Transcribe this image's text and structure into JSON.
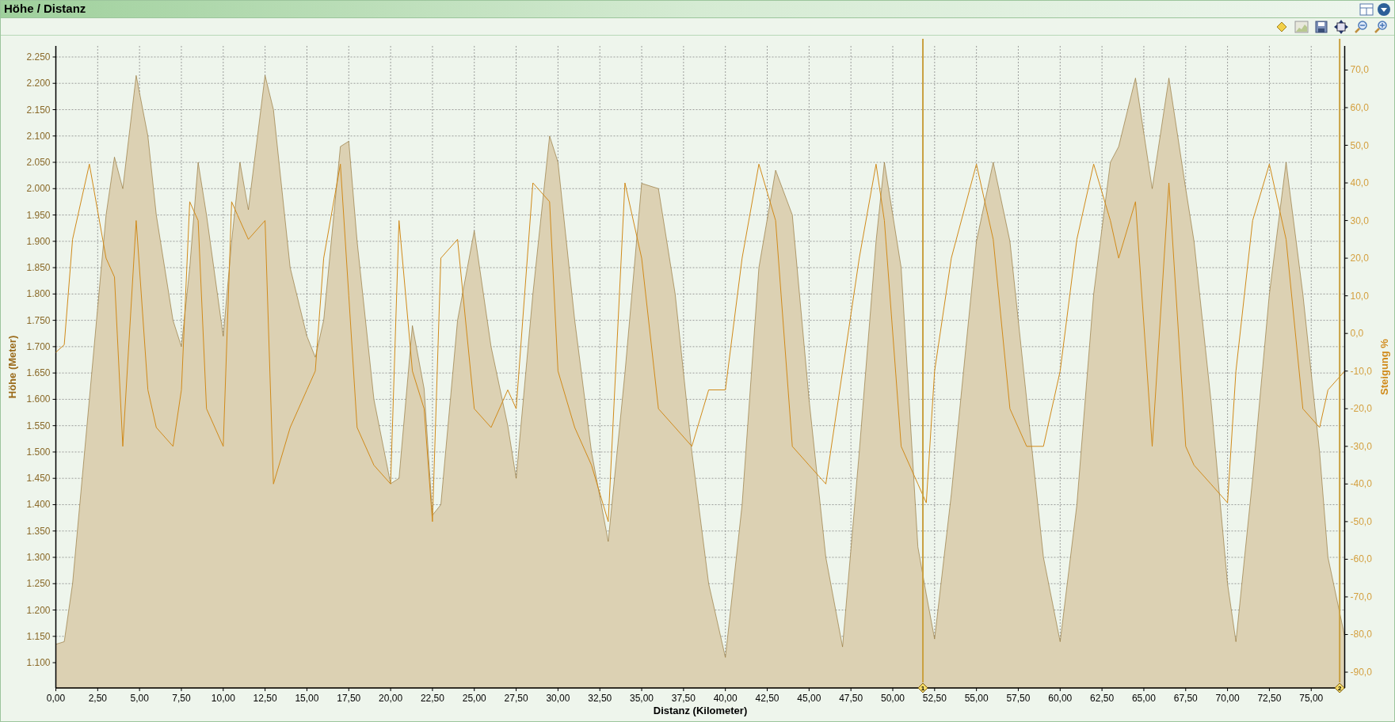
{
  "panel": {
    "title": "Höhe / Distanz"
  },
  "elevation_chart": {
    "chart_data": {
      "type": "area",
      "grid": true,
      "xlabel": "Distanz (Kilometer)",
      "ylabel": "Höhe (Meter)",
      "xlim": [
        0,
        77
      ],
      "ylim": [
        1052,
        2271
      ],
      "x": [
        0,
        0.5,
        1,
        2,
        3,
        3.5,
        4,
        4.8,
        5.5,
        6,
        7,
        7.5,
        8,
        8.5,
        9,
        10,
        10.5,
        11,
        11.5,
        12.5,
        13,
        14,
        15,
        15.5,
        16,
        17,
        17.5,
        18,
        19,
        20,
        20.5,
        21.3,
        22,
        22.5,
        23,
        24,
        25,
        26,
        27,
        27.5,
        28.5,
        29.5,
        30,
        31,
        32,
        33,
        34,
        35,
        36,
        37,
        38,
        39,
        40,
        41,
        42,
        43,
        44,
        45,
        46,
        47,
        48,
        49,
        49.5,
        50.5,
        51.5,
        52,
        52.5,
        53.5,
        55,
        56,
        57,
        58,
        59,
        60,
        61,
        62,
        63,
        63.5,
        64.5,
        65.5,
        66.5,
        67.5,
        68,
        69,
        70,
        70.5,
        71.5,
        72.5,
        73.5,
        74.5,
        75.5,
        76,
        77
      ],
      "series": [
        {
          "color": "#8b6a2a",
          "values": [
            1135,
            1140,
            1250,
            1600,
            1950,
            2060,
            2000,
            2215,
            2100,
            1950,
            1750,
            1700,
            1850,
            2050,
            1950,
            1720,
            1900,
            2050,
            1960,
            2215,
            2150,
            1850,
            1720,
            1680,
            1750,
            2080,
            2090,
            1900,
            1600,
            1440,
            1450,
            1740,
            1620,
            1380,
            1400,
            1750,
            1920,
            1700,
            1550,
            1450,
            1800,
            2100,
            2050,
            1750,
            1500,
            1330,
            1650,
            2010,
            2000,
            1800,
            1500,
            1250,
            1110,
            1400,
            1850,
            2035,
            1950,
            1600,
            1300,
            1130,
            1500,
            1900,
            2050,
            1850,
            1320,
            1230,
            1145,
            1420,
            1900,
            2050,
            1900,
            1600,
            1300,
            1140,
            1400,
            1800,
            2050,
            2080,
            2210,
            2000,
            2210,
            2000,
            1900,
            1600,
            1250,
            1140,
            1450,
            1800,
            2050,
            1800,
            1500,
            1300,
            1150
          ]
        }
      ],
      "xticks": [
        {
          "value": 0,
          "label": "0,00"
        },
        {
          "value": 2.5,
          "label": "2,50"
        },
        {
          "value": 5,
          "label": "5,00"
        },
        {
          "value": 7.5,
          "label": "7,50"
        },
        {
          "value": 10,
          "label": "10,00"
        },
        {
          "value": 12.5,
          "label": "12,50"
        },
        {
          "value": 15,
          "label": "15,00"
        },
        {
          "value": 17.5,
          "label": "17,50"
        },
        {
          "value": 20,
          "label": "20,00"
        },
        {
          "value": 22.5,
          "label": "22,50"
        },
        {
          "value": 25,
          "label": "25,00"
        },
        {
          "value": 27.5,
          "label": "27,50"
        },
        {
          "value": 30,
          "label": "30,00"
        },
        {
          "value": 32.5,
          "label": "32,50"
        },
        {
          "value": 35,
          "label": "35,00"
        },
        {
          "value": 37.5,
          "label": "37,50"
        },
        {
          "value": 40,
          "label": "40,00"
        },
        {
          "value": 42.5,
          "label": "42,50"
        },
        {
          "value": 45,
          "label": "45,00"
        },
        {
          "value": 47.5,
          "label": "47,50"
        },
        {
          "value": 50,
          "label": "50,00"
        },
        {
          "value": 52.5,
          "label": "52,50"
        },
        {
          "value": 55,
          "label": "55,00"
        },
        {
          "value": 57.5,
          "label": "57,50"
        },
        {
          "value": 60,
          "label": "60,00"
        },
        {
          "value": 62.5,
          "label": "62,50"
        },
        {
          "value": 65,
          "label": "65,00"
        },
        {
          "value": 67.5,
          "label": "67,50"
        },
        {
          "value": 70,
          "label": "70,00"
        },
        {
          "value": 72.5,
          "label": "72,50"
        },
        {
          "value": 75,
          "label": "75,00"
        }
      ],
      "yticks": [
        {
          "value": 1100,
          "label": "1.100"
        },
        {
          "value": 1150,
          "label": "1.150"
        },
        {
          "value": 1200,
          "label": "1.200"
        },
        {
          "value": 1250,
          "label": "1.250"
        },
        {
          "value": 1300,
          "label": "1.300"
        },
        {
          "value": 1350,
          "label": "1.350"
        },
        {
          "value": 1400,
          "label": "1.400"
        },
        {
          "value": 1450,
          "label": "1.450"
        },
        {
          "value": 1500,
          "label": "1.500"
        },
        {
          "value": 1550,
          "label": "1.550"
        },
        {
          "value": 1600,
          "label": "1.600"
        },
        {
          "value": 1650,
          "label": "1.650"
        },
        {
          "value": 1700,
          "label": "1.700"
        },
        {
          "value": 1750,
          "label": "1.750"
        },
        {
          "value": 1800,
          "label": "1.800"
        },
        {
          "value": 1850,
          "label": "1.850"
        },
        {
          "value": 1900,
          "label": "1.900"
        },
        {
          "value": 1950,
          "label": "1.950"
        },
        {
          "value": 2000,
          "label": "2.000"
        },
        {
          "value": 2050,
          "label": "2.050"
        },
        {
          "value": 2100,
          "label": "2.100"
        },
        {
          "value": 2150,
          "label": "2.150"
        },
        {
          "value": 2200,
          "label": "2.200"
        },
        {
          "value": 2250,
          "label": "2.250"
        }
      ]
    }
  },
  "gradient_chart": {
    "chart_data": {
      "type": "line",
      "ylabel": "Steigung %",
      "xlim": [
        0,
        77
      ],
      "ylim": [
        -94.2,
        76.4
      ],
      "x": [
        0,
        0.5,
        1,
        2,
        3,
        3.5,
        4,
        4.8,
        5.5,
        6,
        7,
        7.5,
        8,
        8.5,
        9,
        10,
        10.5,
        11,
        11.5,
        12.5,
        13,
        14,
        15,
        15.5,
        16,
        17,
        17.5,
        18,
        19,
        20,
        20.5,
        21.3,
        22,
        22.5,
        23,
        24,
        25,
        26,
        27,
        27.5,
        28.5,
        29.5,
        30,
        31,
        32,
        33,
        34,
        35,
        36,
        37,
        38,
        39,
        40,
        41,
        42,
        43,
        44,
        45,
        46,
        47,
        48,
        49,
        49.5,
        50.5,
        51.5,
        52,
        52.5,
        53.5,
        55,
        56,
        57,
        58,
        59,
        60,
        61,
        62,
        63,
        63.5,
        64.5,
        65.5,
        66.5,
        67.5,
        68,
        69,
        70,
        70.5,
        71.5,
        72.5,
        73.5,
        74.5,
        75.5,
        76,
        77
      ],
      "series": [
        {
          "color": "#d08a1a",
          "values": [
            -5,
            -3,
            25,
            45,
            20,
            15,
            -30,
            30,
            -15,
            -25,
            -30,
            -15,
            35,
            30,
            -20,
            -30,
            35,
            30,
            25,
            30,
            -40,
            -25,
            -15,
            -10,
            20,
            45,
            10,
            -25,
            -35,
            -40,
            30,
            -10,
            -20,
            -50,
            20,
            25,
            -20,
            -25,
            -15,
            -20,
            40,
            35,
            -10,
            -25,
            -35,
            -50,
            40,
            20,
            -20,
            -25,
            -30,
            -15,
            -15,
            20,
            45,
            30,
            -30,
            -35,
            -40,
            -10,
            20,
            45,
            30,
            -30,
            -40,
            -45,
            -10,
            20,
            45,
            25,
            -20,
            -30,
            -30,
            -10,
            25,
            45,
            30,
            20,
            35,
            -30,
            40,
            -30,
            -35,
            -40,
            -45,
            -10,
            30,
            45,
            25,
            -20,
            -25,
            -15,
            -10
          ]
        }
      ],
      "yticks": [
        {
          "value": 70,
          "label": "70,0"
        },
        {
          "value": 60,
          "label": "60,0"
        },
        {
          "value": 50,
          "label": "50,0"
        },
        {
          "value": 40,
          "label": "40,0"
        },
        {
          "value": 30,
          "label": "30,0"
        },
        {
          "value": 20,
          "label": "20,0"
        },
        {
          "value": 10,
          "label": "10,0"
        },
        {
          "value": 0,
          "label": "0,0"
        },
        {
          "value": -10,
          "label": "-10,0"
        },
        {
          "value": -20,
          "label": "-20,0"
        },
        {
          "value": -30,
          "label": "-30,0"
        },
        {
          "value": -40,
          "label": "-40,0"
        },
        {
          "value": -50,
          "label": "-50,0"
        },
        {
          "value": -60,
          "label": "-60,0"
        },
        {
          "value": -70,
          "label": "-70,0"
        },
        {
          "value": -80,
          "label": "-80,0"
        },
        {
          "value": -90,
          "label": "-90,0"
        }
      ],
      "annotations": [
        {
          "x": 51.8,
          "text": "1"
        },
        {
          "x": 76.7,
          "text": "2"
        }
      ]
    }
  }
}
